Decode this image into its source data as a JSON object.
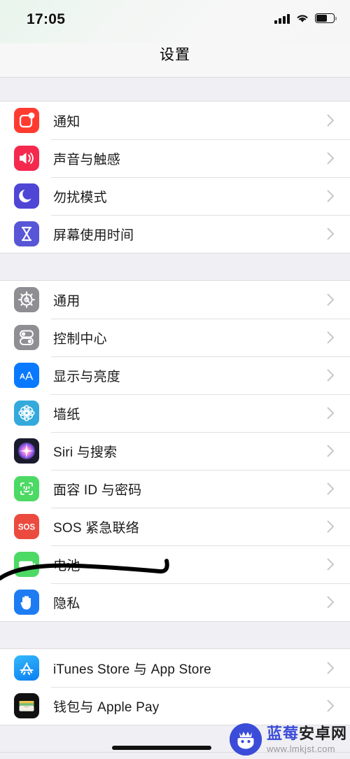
{
  "status_bar": {
    "time": "17:05",
    "signal_icon": "cellular-signal-icon",
    "wifi_icon": "wifi-icon",
    "battery_icon": "battery-icon",
    "battery_level_percent": 55
  },
  "nav": {
    "title": "设置"
  },
  "groups": [
    {
      "id": "notifications-group",
      "rows": [
        {
          "label": "通知",
          "icon": "notifications-icon",
          "color": "#FF3B30"
        },
        {
          "label": "声音与触感",
          "icon": "sounds-haptics-icon",
          "color": "#F5294E"
        },
        {
          "label": "勿扰模式",
          "icon": "do-not-disturb-icon",
          "color": "#4F46D6"
        },
        {
          "label": "屏幕使用时间",
          "icon": "screen-time-icon",
          "color": "#5856D6"
        }
      ]
    },
    {
      "id": "system-group",
      "rows": [
        {
          "label": "通用",
          "icon": "general-gear-icon",
          "color": "#8E8E93"
        },
        {
          "label": "控制中心",
          "icon": "control-center-icon",
          "color": "#8E8E93"
        },
        {
          "label": "显示与亮度",
          "icon": "display-brightness-icon",
          "color": "#097AFF"
        },
        {
          "label": "墙纸",
          "icon": "wallpaper-icon",
          "color": "#34AADC"
        },
        {
          "label": "Siri 与搜索",
          "icon": "siri-icon",
          "color": "#1B1B2E"
        },
        {
          "label": "面容 ID 与密码",
          "icon": "face-id-icon",
          "color": "#4CD964"
        },
        {
          "label": "SOS 紧急联络",
          "icon": "emergency-sos-icon",
          "color": "#EB4B3F"
        },
        {
          "label": "电池",
          "icon": "battery-settings-icon",
          "color": "#4CD964"
        },
        {
          "label": "隐私",
          "icon": "privacy-hand-icon",
          "color": "#1D7CF2"
        }
      ]
    },
    {
      "id": "store-group",
      "rows": [
        {
          "label": "iTunes Store 与 App Store",
          "icon": "app-store-icon",
          "color": "#1E9BF5"
        },
        {
          "label": "钱包与 Apple Pay",
          "icon": "wallet-icon",
          "color": "#111111"
        }
      ]
    }
  ],
  "annotation": {
    "name": "handdrawn-underline-battery",
    "color": "#000000",
    "target_row_label": "电池"
  },
  "home_indicator": {
    "name": "home-indicator"
  },
  "watermark": {
    "brand_blue": "蓝莓",
    "brand_dark": "安卓网",
    "url": "www.lmkjst.com",
    "logo_color": "#3B4CD8"
  },
  "chevron_color": "#C7C7CC"
}
